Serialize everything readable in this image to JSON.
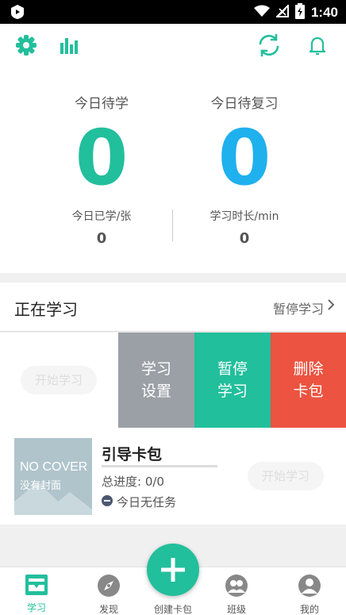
{
  "status_bar": {
    "time": "1:40"
  },
  "colors": {
    "teal": "#22bf9c",
    "blue": "#1fb0ee",
    "gray": "#9ba0a6",
    "red": "#ec5340"
  },
  "stats": {
    "today_to_learn_label": "今日待学",
    "today_to_learn_value": "0",
    "today_to_review_label": "今日待复习",
    "today_to_review_value": "0",
    "learned_today_label": "今日已学/张",
    "learned_today_value": "0",
    "study_time_label": "学习时长/min",
    "study_time_value": "0"
  },
  "section": {
    "title": "正在学习",
    "link": "暂停学习"
  },
  "swipe_row": {
    "start_button": "开始学习",
    "actions": [
      {
        "label": "学习设置"
      },
      {
        "label": "暂停学习"
      },
      {
        "label": "删除卡包"
      }
    ]
  },
  "deck": {
    "cover_line1": "NO COVER",
    "cover_line2": "没有封面",
    "title": "引导卡包",
    "progress": "总进度: 0/0",
    "task": "今日无任务",
    "start_button": "开始学习"
  },
  "tabs": [
    {
      "label": "学习",
      "icon": "study-icon"
    },
    {
      "label": "发现",
      "icon": "compass-icon"
    },
    {
      "label": "创建卡包",
      "icon": "plus-icon"
    },
    {
      "label": "班级",
      "icon": "class-icon"
    },
    {
      "label": "我的",
      "icon": "profile-icon"
    }
  ]
}
